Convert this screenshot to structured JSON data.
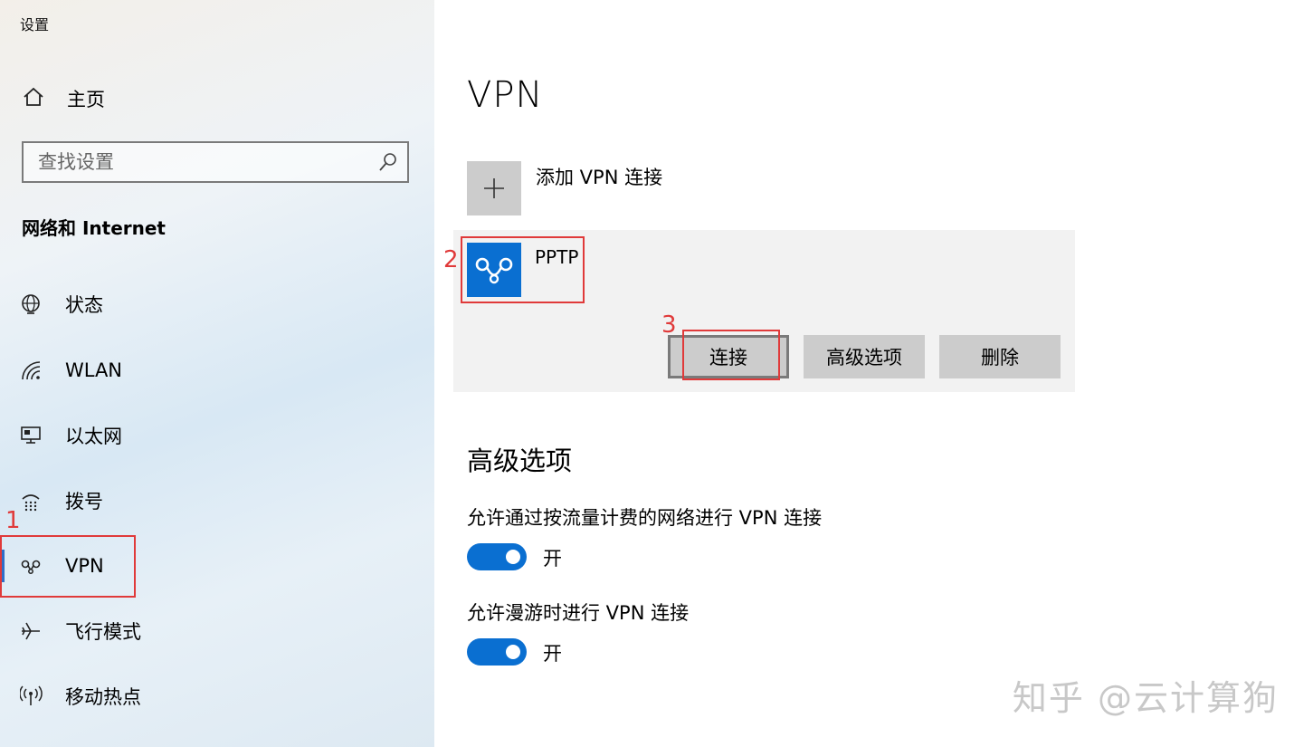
{
  "window": {
    "title": "设置"
  },
  "sidebar": {
    "home_label": "主页",
    "search_placeholder": "查找设置",
    "section_title": "网络和 Internet",
    "items": [
      {
        "label": "状态",
        "icon": "globe-icon"
      },
      {
        "label": "WLAN",
        "icon": "wifi-icon"
      },
      {
        "label": "以太网",
        "icon": "ethernet-icon"
      },
      {
        "label": "拨号",
        "icon": "dialup-icon"
      },
      {
        "label": "VPN",
        "icon": "vpn-icon",
        "selected": true
      },
      {
        "label": "飞行模式",
        "icon": "airplane-icon"
      },
      {
        "label": "移动热点",
        "icon": "hotspot-icon"
      }
    ]
  },
  "main": {
    "title": "VPN",
    "add_vpn_label": "添加 VPN 连接",
    "connection": {
      "name": "PPTP",
      "buttons": {
        "connect": "连接",
        "advanced": "高级选项",
        "delete": "删除"
      }
    },
    "advanced": {
      "heading": "高级选项",
      "options": [
        {
          "label": "允许通过按流量计费的网络进行 VPN 连接",
          "state": "开",
          "on": true
        },
        {
          "label": "允许漫游时进行 VPN 连接",
          "state": "开",
          "on": true
        }
      ]
    }
  },
  "annotations": {
    "n1": "1",
    "n2": "2",
    "n3": "3",
    "color": "#e03a3a"
  },
  "watermark": "知乎 @云计算狗",
  "colors": {
    "accent": "#0a6fd1",
    "selected_bar": "#2f6ec8",
    "button_bg": "#cccccc",
    "card_bg": "#f2f2f2"
  }
}
